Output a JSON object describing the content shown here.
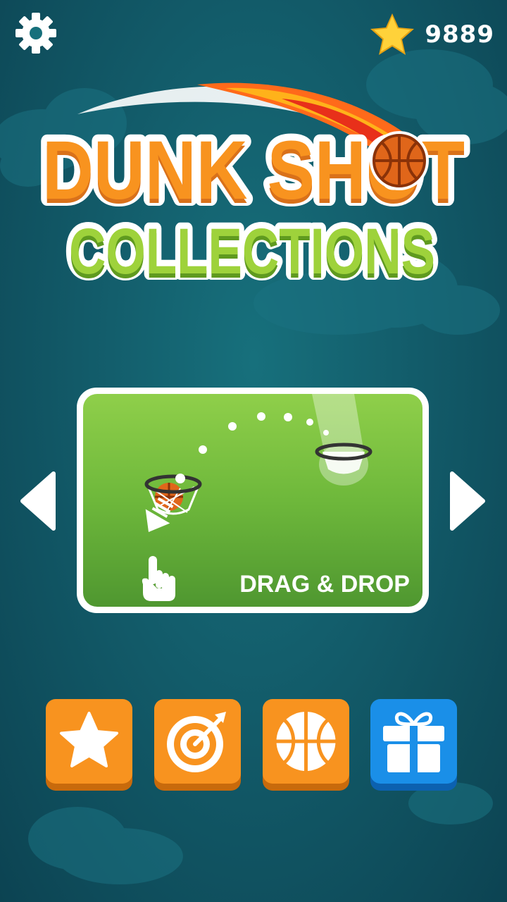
{
  "hud": {
    "settings_icon": "gear-icon",
    "currency_icon": "star-icon",
    "star_count": "9889"
  },
  "logo": {
    "line1": "DUNK SHOT",
    "line2": "COLLECTIONS"
  },
  "mode_card": {
    "caption": "DRAG & DROP"
  },
  "nav": {
    "prev_icon": "chevron-left-icon",
    "next_icon": "chevron-right-icon"
  },
  "bottom_buttons": [
    {
      "icon": "star-icon",
      "color": "#f8931f"
    },
    {
      "icon": "target-icon",
      "color": "#f8931f"
    },
    {
      "icon": "basketball-icon",
      "color": "#f8931f"
    },
    {
      "icon": "gift-icon",
      "color": "#1a8fe8"
    }
  ],
  "colors": {
    "background": "#135e6c",
    "orange": "#f8931f",
    "green": "#8dc63f",
    "blue": "#1a8fe8"
  }
}
